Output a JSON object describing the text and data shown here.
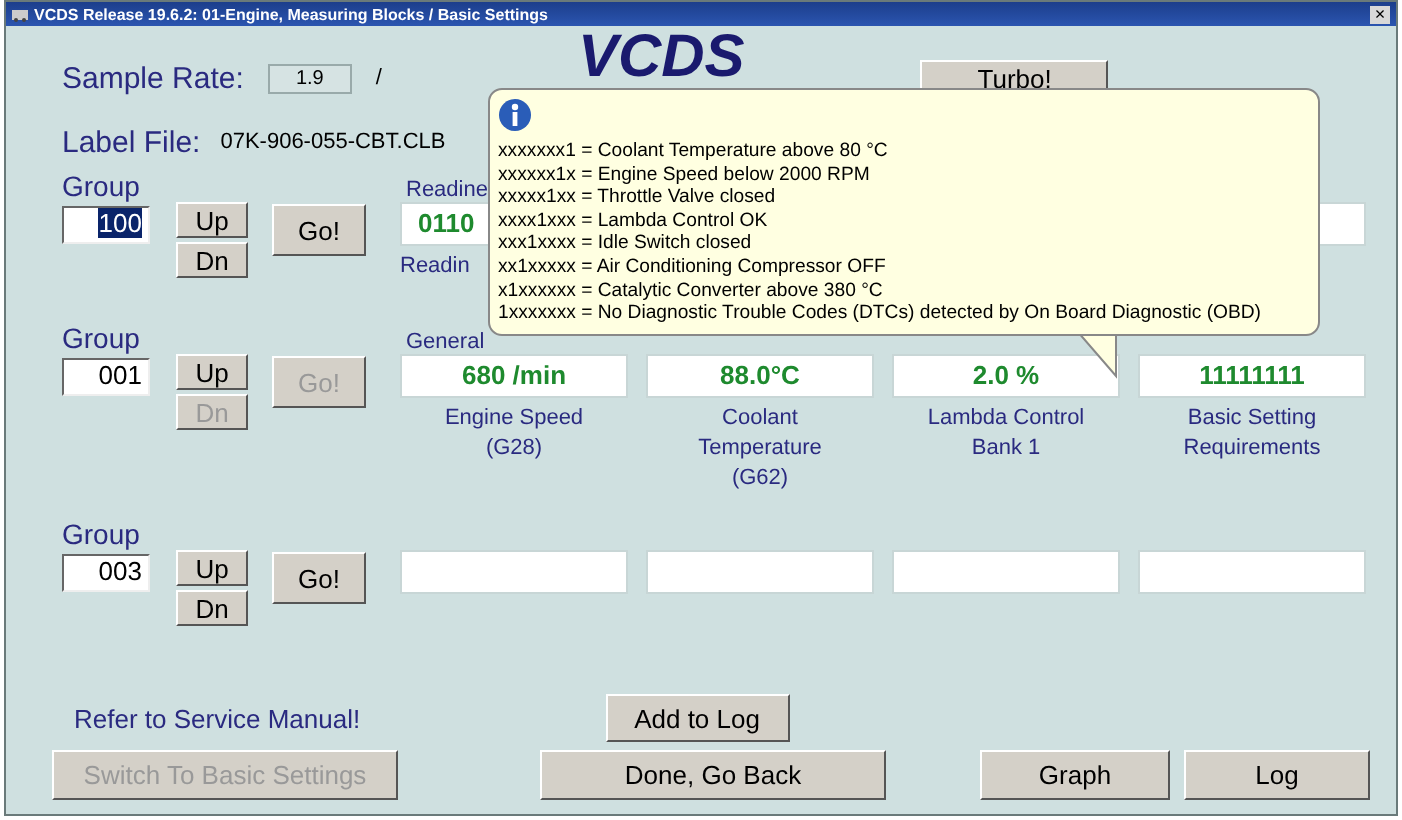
{
  "window": {
    "title": "VCDS Release 19.6.2: 01-Engine, Measuring Blocks / Basic Settings",
    "close": "×"
  },
  "sample_rate": {
    "label": "Sample Rate:",
    "value": "1.9",
    "separator": "/"
  },
  "logo": "VCDS",
  "turbo_button": "Turbo!",
  "label_file": {
    "label": "Label File:",
    "value": "07K-906-055-CBT.CLB"
  },
  "groups": [
    {
      "label": "Group",
      "number": "100",
      "selected": true,
      "up": {
        "label": "Up",
        "disabled": false
      },
      "down": {
        "label": "Dn",
        "disabled": false
      },
      "go": {
        "label": "Go!",
        "disabled": false
      },
      "heading": "Readine",
      "fields": [
        {
          "value": "0110",
          "label": "Readin"
        }
      ]
    },
    {
      "label": "Group",
      "number": "001",
      "selected": false,
      "up": {
        "label": "Up",
        "disabled": false
      },
      "down": {
        "label": "Dn",
        "disabled": true
      },
      "go": {
        "label": "Go!",
        "disabled": true
      },
      "heading": "General",
      "fields": [
        {
          "value": "680 /min",
          "label": "Engine Speed (G28)"
        },
        {
          "value": "88.0°C",
          "label": "Coolant Temperature (G62)"
        },
        {
          "value": "2.0 %",
          "label": "Lambda Control Bank 1"
        },
        {
          "value": "11111111",
          "label": "Basic Setting Requirements"
        }
      ]
    },
    {
      "label": "Group",
      "number": "003",
      "selected": false,
      "up": {
        "label": "Up",
        "disabled": false
      },
      "down": {
        "label": "Dn",
        "disabled": false
      },
      "go": {
        "label": "Go!",
        "disabled": false
      }
    }
  ],
  "tooltip": {
    "lines": [
      "xxxxxxx1 = Coolant Temperature above 80 °C",
      "xxxxxx1x = Engine Speed below 2000 RPM",
      "xxxxx1xx = Throttle Valve closed",
      "xxxx1xxx = Lambda Control OK",
      "xxx1xxxx = Idle Switch closed",
      "xx1xxxxx = Air Conditioning Compressor OFF",
      "x1xxxxxx = Catalytic Converter above 380 °C",
      "1xxxxxxx = No Diagnostic Trouble Codes (DTCs) detected by On Board Diagnostic (OBD)"
    ]
  },
  "notice": "Refer to Service Manual!",
  "buttons": [
    {
      "label": "Add to Log",
      "disabled": false
    },
    {
      "label": "Switch To Basic Settings",
      "disabled": true
    },
    {
      "label": "Done, Go Back",
      "disabled": false
    },
    {
      "label": "Graph",
      "disabled": false
    },
    {
      "label": "Log",
      "disabled": false
    }
  ]
}
